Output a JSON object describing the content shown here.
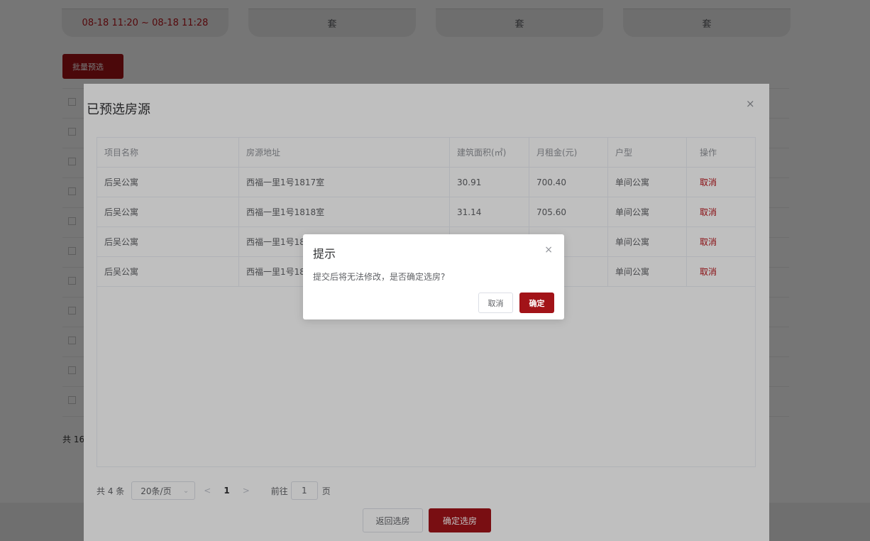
{
  "time_cards": [
    {
      "label": "08-18 11:20 ~ 08-18 11:28"
    },
    {
      "label": "套"
    },
    {
      "label": "套"
    },
    {
      "label": "套"
    }
  ],
  "batch_button_label": "批量预选",
  "bg_total": "共 16",
  "footer": {
    "return_label": "返回选房",
    "confirm_label": "确定选房"
  },
  "dialog": {
    "title": "已预选房源",
    "close": "×",
    "columns": [
      "项目名称",
      "房源地址",
      "建筑面积(㎡)",
      "月租金(元)",
      "户型",
      "操作"
    ],
    "rows": [
      {
        "project": "后吴公寓",
        "address": "西福一里1号1817室",
        "area": "30.91",
        "rent": "700.40",
        "type": "单间公寓",
        "action": "取消"
      },
      {
        "project": "后吴公寓",
        "address": "西福一里1号1818室",
        "area": "31.14",
        "rent": "705.60",
        "type": "单间公寓",
        "action": "取消"
      },
      {
        "project": "后吴公寓",
        "address": "西福一里1号18",
        "area": "",
        "rent": "",
        "type": "单间公寓",
        "action": "取消"
      },
      {
        "project": "后吴公寓",
        "address": "西福一里1号18",
        "area": "",
        "rent": "",
        "type": "单间公寓",
        "action": "取消"
      }
    ],
    "pagination": {
      "total": "共 4 条",
      "page_size": "20条/页",
      "prev": "<",
      "current": "1",
      "next": ">",
      "goto_label": "前往",
      "goto_value": "1",
      "page_unit": "页"
    }
  },
  "confirm_box": {
    "title": "提示",
    "close": "×",
    "message": "提交后将无法修改，是否确定选房?",
    "cancel_label": "取消",
    "ok_label": "确定"
  },
  "colors": {
    "accent": "#a21318",
    "link": "#b8141b"
  },
  "icons": {
    "close": "close-icon",
    "chevron": "chevron-down-icon"
  }
}
